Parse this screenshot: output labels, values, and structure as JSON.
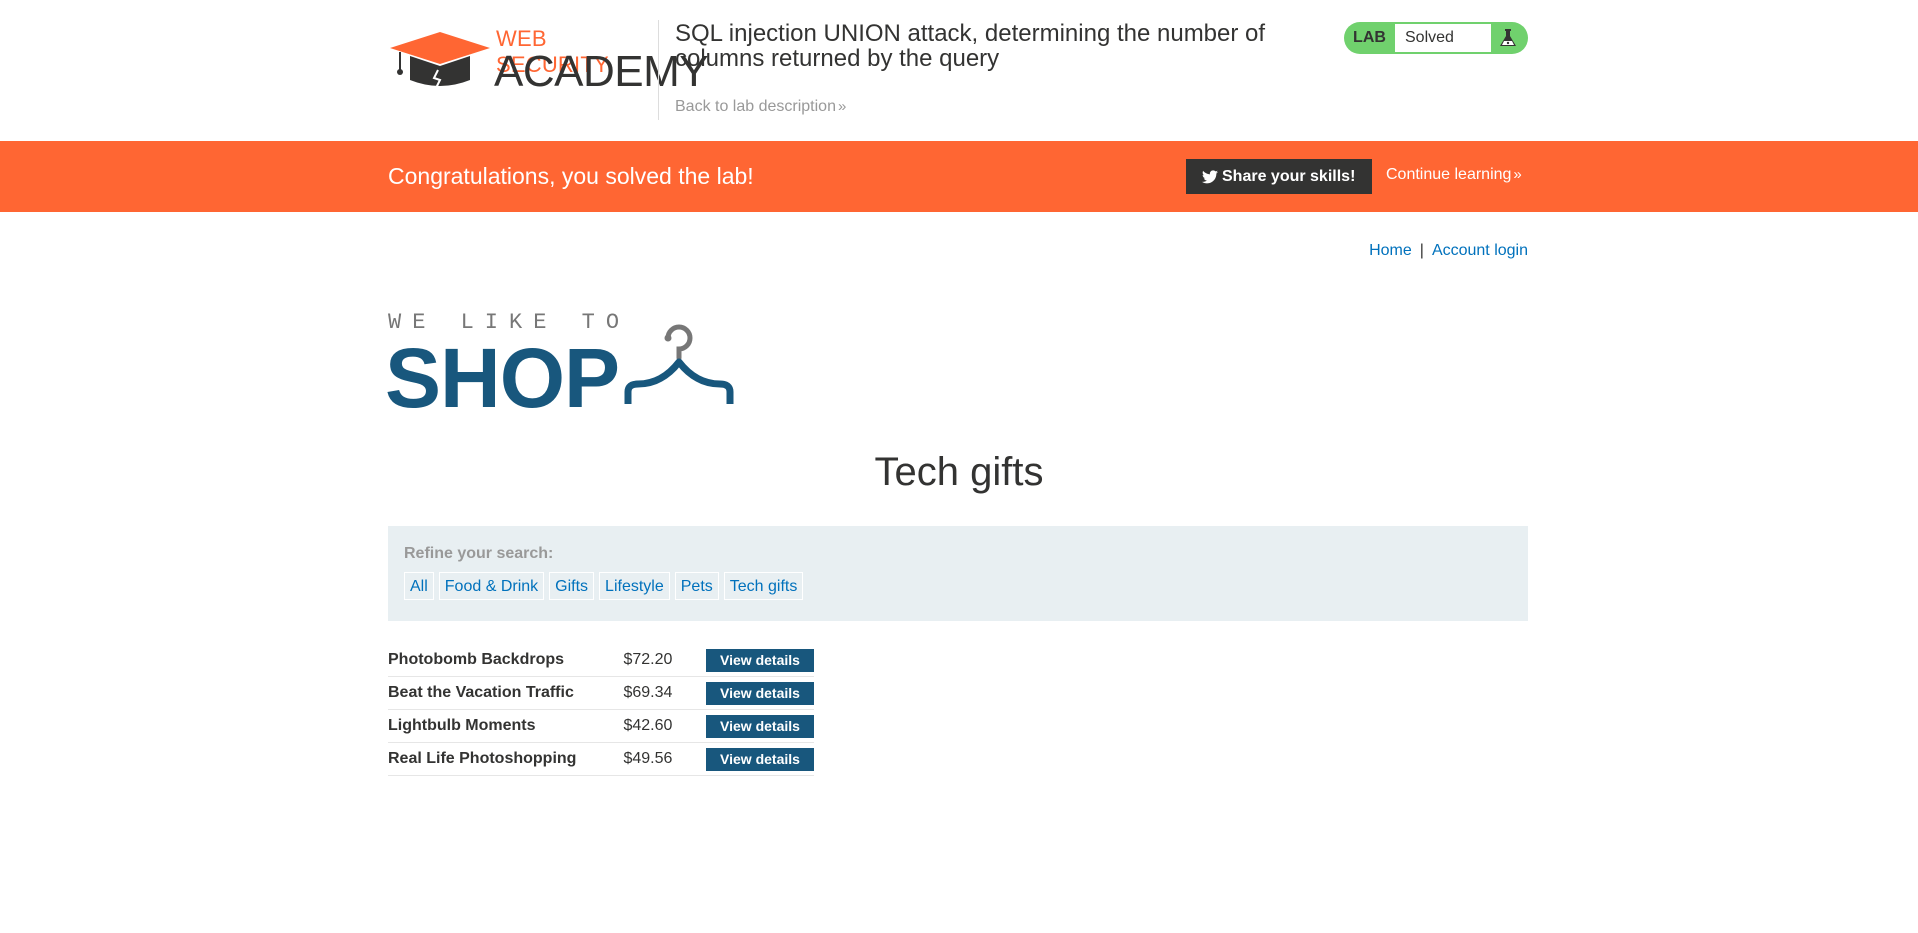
{
  "academy": {
    "logo_top": "WEB SECURITY",
    "logo_bottom": "ACADEMY",
    "lab_title": "SQL injection UNION attack, determining the number of columns returned by the query",
    "back_link": "Back to lab description",
    "chevron": "»",
    "badge": {
      "label": "LAB",
      "status": "Solved",
      "icon": "flask-icon"
    }
  },
  "banner": {
    "message": "Congratulations, you solved the lab!",
    "share_label": "Share your skills!",
    "share_icon": "twitter-icon",
    "continue_label": "Continue learning",
    "chevron": "»"
  },
  "nav": {
    "home": "Home",
    "separator": "|",
    "account": "Account login"
  },
  "shop_logo": {
    "tagline": "WE LIKE TO",
    "word": "SHOP",
    "icon": "hanger-icon"
  },
  "page": {
    "title": "Tech gifts"
  },
  "filter": {
    "label": "Refine your search:",
    "categories": [
      "All",
      "Food & Drink",
      "Gifts",
      "Lifestyle",
      "Pets",
      "Tech gifts"
    ]
  },
  "products": [
    {
      "name": "Photobomb Backdrops",
      "price": "$72.20",
      "button": "View details"
    },
    {
      "name": "Beat the Vacation Traffic",
      "price": "$69.34",
      "button": "View details"
    },
    {
      "name": "Lightbulb Moments",
      "price": "$42.60",
      "button": "View details"
    },
    {
      "name": "Real Life Photoshopping",
      "price": "$49.56",
      "button": "View details"
    }
  ],
  "colors": {
    "brand_orange": "#ff6633",
    "lab_green": "#70d16d",
    "shop_blue": "#18577d",
    "link_blue": "#0071bc",
    "filter_bg": "#e8eff2"
  }
}
